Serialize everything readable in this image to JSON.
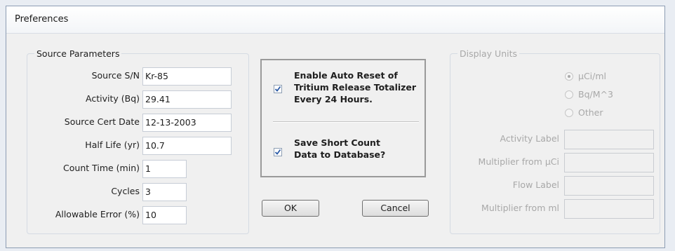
{
  "window": {
    "title": "Preferences"
  },
  "source_parameters": {
    "legend": "Source Parameters",
    "fields": [
      {
        "label": "Source S/N",
        "value": "Kr-85"
      },
      {
        "label": "Activity (Bq)",
        "value": "29.41"
      },
      {
        "label": "Source Cert Date",
        "value": "12-13-2003"
      },
      {
        "label": "Half Life (yr)",
        "value": "10.7"
      },
      {
        "label": "Count Time (min)",
        "value": "1"
      },
      {
        "label": "Cycles",
        "value": "3"
      },
      {
        "label": "Allowable Error (%)",
        "value": "10"
      }
    ]
  },
  "options": {
    "auto_reset": {
      "checked": true,
      "lines": [
        "Enable Auto Reset of",
        "Tritium Release Totalizer",
        "Every 24 Hours."
      ]
    },
    "save_short_count": {
      "checked": true,
      "lines": [
        "Save Short Count",
        "Data to Database?"
      ]
    }
  },
  "buttons": {
    "ok": "OK",
    "cancel": "Cancel"
  },
  "display_units": {
    "legend": "Display Units",
    "enabled": false,
    "radios": [
      {
        "label": "µCi/ml",
        "selected": true
      },
      {
        "label": "Bq/M^3",
        "selected": false
      },
      {
        "label": "Other",
        "selected": false
      }
    ],
    "fields": [
      {
        "label": "Activity Label",
        "value": ""
      },
      {
        "label": "Multiplier from µCi",
        "value": ""
      },
      {
        "label": "Flow Label",
        "value": ""
      },
      {
        "label": "Multiplier from ml",
        "value": ""
      }
    ]
  },
  "colors": {
    "check": "#2b5aa6",
    "disabled_text": "#a8a8a8",
    "window_bg": "#f0f0f0"
  }
}
